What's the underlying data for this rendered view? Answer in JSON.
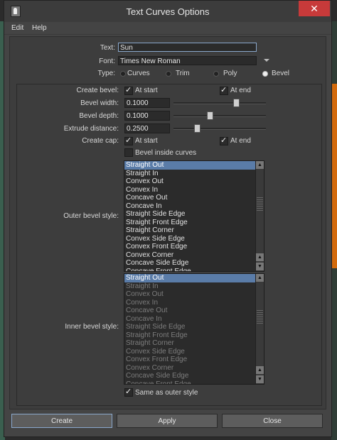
{
  "window": {
    "title": "Text Curves Options",
    "close_glyph": "✕"
  },
  "menu": [
    "Edit",
    "Help"
  ],
  "text_field": {
    "label": "Text:",
    "value": "Sun"
  },
  "font_field": {
    "label": "Font:",
    "value": "Times New Roman"
  },
  "type": {
    "label": "Type:",
    "options": [
      "Curves",
      "Trim",
      "Poly",
      "Bevel"
    ],
    "selected": "Bevel"
  },
  "create_bevel": {
    "label": "Create bevel:",
    "at_start": "At start",
    "at_end": "At end",
    "at_start_checked": true,
    "at_end_checked": true
  },
  "bevel_width": {
    "label": "Bevel width:",
    "value": "0.1000"
  },
  "bevel_depth": {
    "label": "Bevel depth:",
    "value": "0.1000"
  },
  "extrude_distance": {
    "label": "Extrude distance:",
    "value": "0.2500"
  },
  "create_cap": {
    "label": "Create cap:",
    "at_start": "At start",
    "at_end": "At end",
    "at_start_checked": true,
    "at_end_checked": true
  },
  "bevel_inside_curves": {
    "label": "Bevel inside curves",
    "checked": false
  },
  "outer_bevel_style": {
    "label": "Outer bevel style:",
    "items": [
      "Straight Out",
      "Straight In",
      "Convex Out",
      "Convex In",
      "Concave Out",
      "Concave In",
      "Straight Side Edge",
      "Straight Front Edge",
      "Straight Corner",
      "Convex Side Edge",
      "Convex Front Edge",
      "Convex Corner",
      "Concave Side Edge",
      "Concave Front Edge"
    ],
    "selected": "Straight Out"
  },
  "inner_bevel_style": {
    "label": "Inner bevel style:",
    "items": [
      "Straight Out",
      "Straight In",
      "Convex Out",
      "Convex In",
      "Concave Out",
      "Concave In",
      "Straight Side Edge",
      "Straight Front Edge",
      "Straight Corner",
      "Convex Side Edge",
      "Convex Front Edge",
      "Convex Corner",
      "Concave Side Edge",
      "Concave Front Edge"
    ],
    "selected": "Straight Out"
  },
  "same_as_outer": {
    "label": "Same as outer style",
    "checked": true
  },
  "buttons": {
    "create": "Create",
    "apply": "Apply",
    "close": "Close"
  },
  "colors": {
    "selection": "#5a7ca8",
    "close_button": "#c73a3a",
    "panel": "#3d3d3d"
  }
}
